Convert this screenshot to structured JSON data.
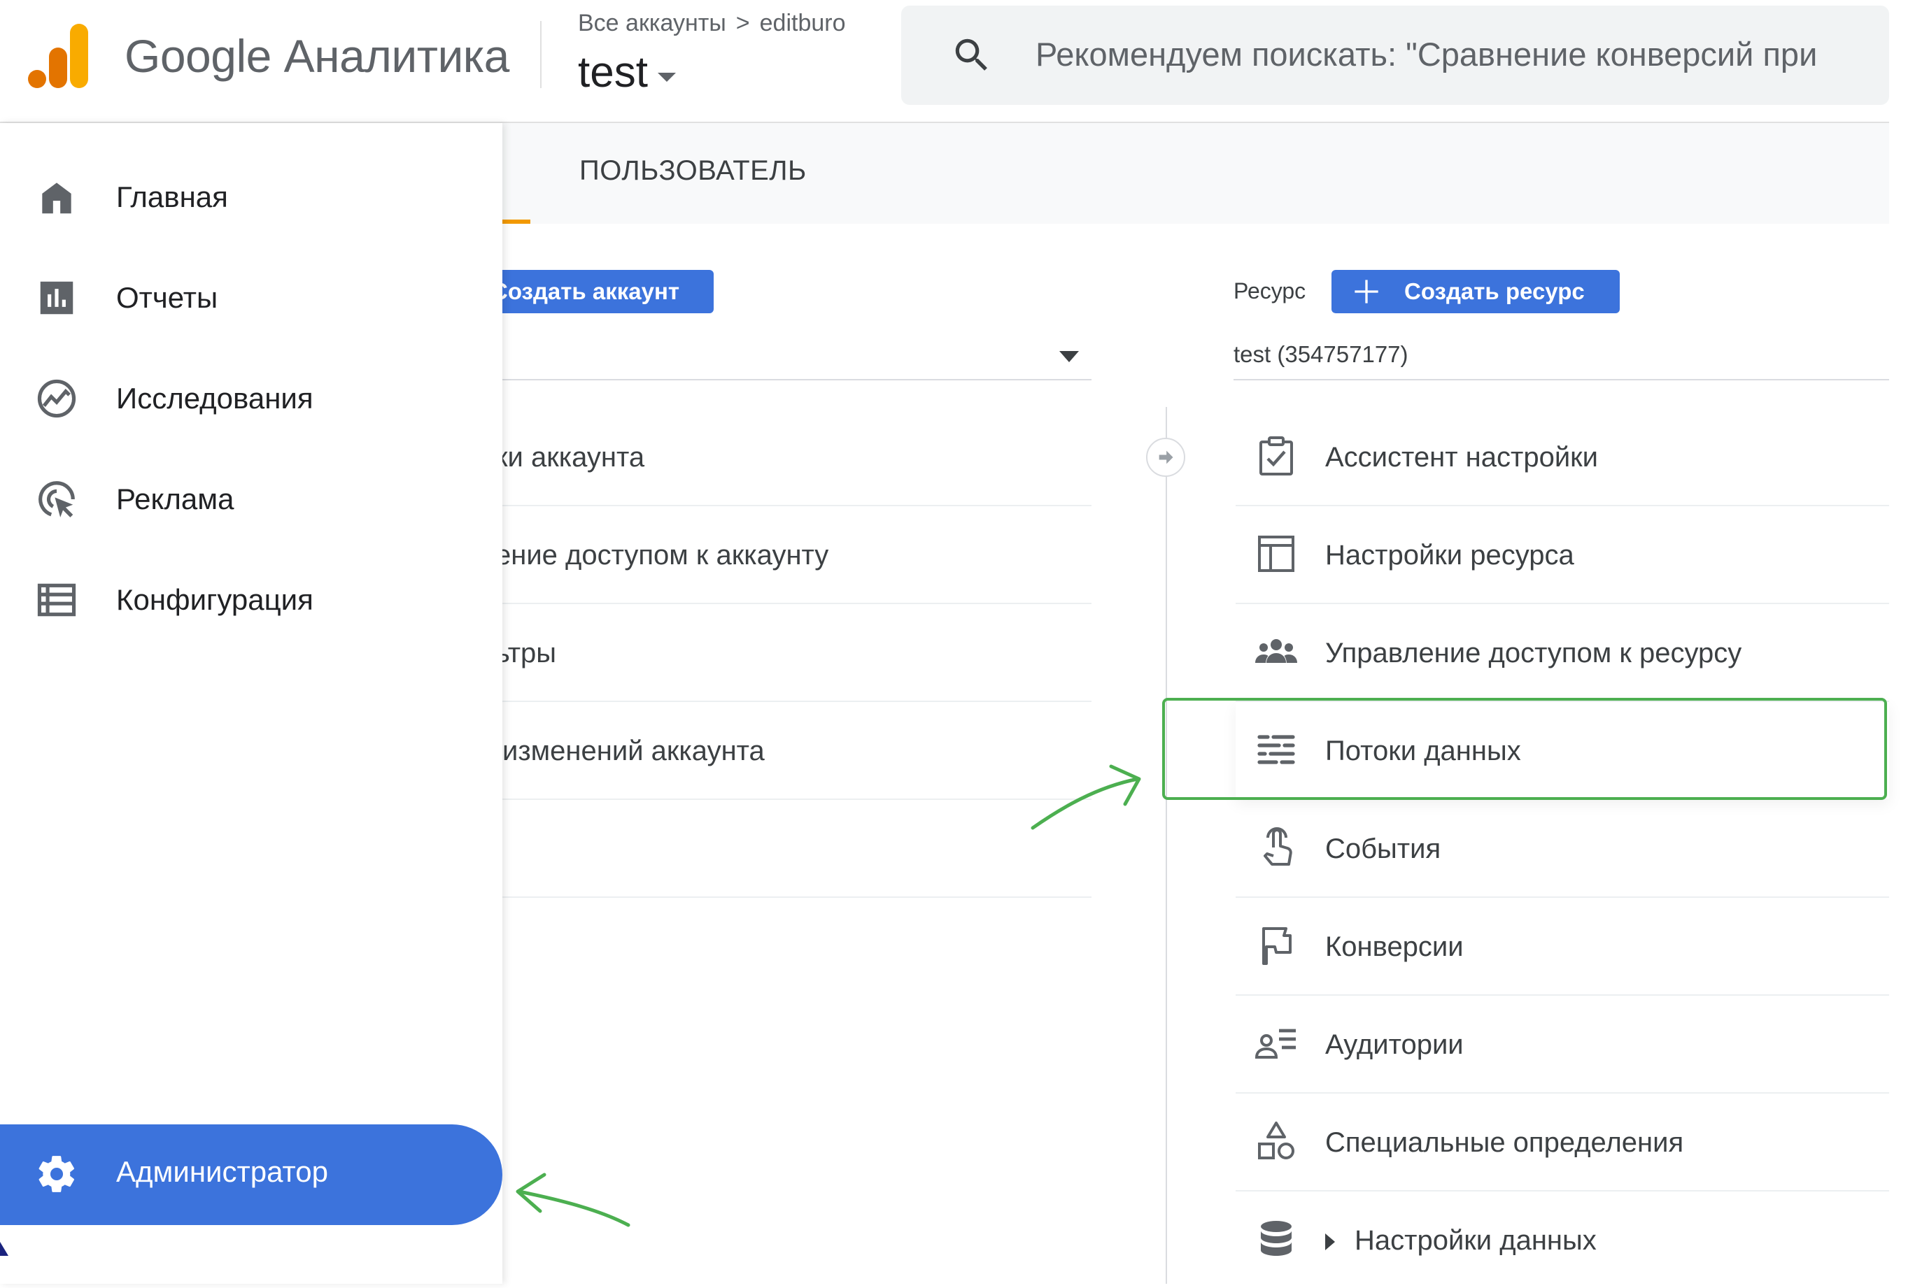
{
  "app": {
    "product_name": "Google Аналитика"
  },
  "breadcrumb": {
    "all_accounts": "Все аккаунты",
    "separator": ">",
    "account": "editburo"
  },
  "property_selector": {
    "name": "test"
  },
  "search": {
    "placeholder": "Рекомендуем поискать: \"Сравнение конверсий при"
  },
  "sidebar": {
    "items": [
      {
        "label": "Главная",
        "icon": "home-icon"
      },
      {
        "label": "Отчеты",
        "icon": "bar-chart-icon"
      },
      {
        "label": "Исследования",
        "icon": "explore-icon"
      },
      {
        "label": "Реклама",
        "icon": "advertising-icon"
      },
      {
        "label": "Конфигурация",
        "icon": "list-icon"
      }
    ],
    "admin": {
      "label": "Администратор",
      "icon": "gear-icon",
      "active": true
    }
  },
  "tabs": {
    "user": "ПОЛЬЗОВАТЕЛЬ"
  },
  "account_column": {
    "create_button": "Создать аккаунт",
    "rows": [
      "ки аккаунта",
      "ение доступом к аккаунту",
      "ьтры",
      "изменений аккаунта",
      ""
    ]
  },
  "property_column": {
    "label": "Ресурс",
    "create_button": "Создать ресурс",
    "selected": "test (354757177)",
    "rows": [
      {
        "label": "Ассистент настройки",
        "icon": "checklist-icon"
      },
      {
        "label": "Настройки ресурса",
        "icon": "layout-icon"
      },
      {
        "label": "Управление доступом к ресурсу",
        "icon": "people-icon"
      },
      {
        "label": "Потоки данных",
        "icon": "data-streams-icon",
        "highlighted": true
      },
      {
        "label": "События",
        "icon": "touch-icon"
      },
      {
        "label": "Конверсии",
        "icon": "flag-icon"
      },
      {
        "label": "Аудитории",
        "icon": "audience-icon"
      },
      {
        "label": "Специальные определения",
        "icon": "shapes-icon"
      },
      {
        "label": "Настройки данных",
        "icon": "database-icon",
        "expandable": true
      }
    ]
  },
  "colors": {
    "accent_blue": "#3c73dc",
    "highlight_green": "#4caf50",
    "tab_underline": "#f29900",
    "logo_orange": "#f9ab00",
    "logo_dark_orange": "#e37400"
  }
}
